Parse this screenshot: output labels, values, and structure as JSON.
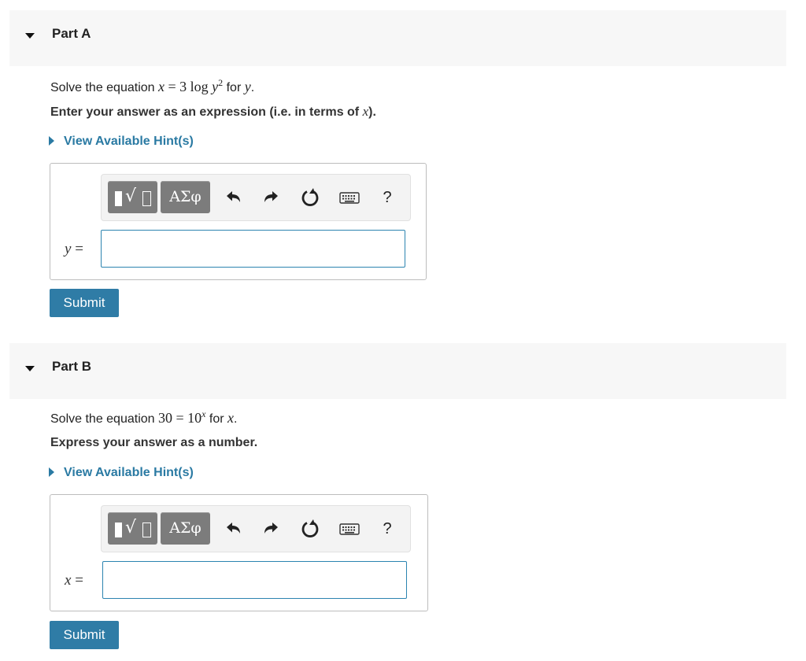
{
  "part_a": {
    "title": "Part A",
    "question_prefix": "Solve the equation",
    "eq_lhs": "x",
    "eq_op": " = 3 log ",
    "eq_var": "y",
    "eq_exp": "2",
    "question_for": " for ",
    "question_var": "y",
    "question_end": ".",
    "instruction_prefix": "Enter your answer as an expression (i.e. in terms of ",
    "instruction_var": "x",
    "instruction_suffix": ").",
    "hint_label": "View Available Hint(s)",
    "greek_label": "ΑΣφ",
    "help_label": "?",
    "answer_var": "y",
    "answer_eq": " =",
    "input_value": "",
    "submit_label": "Submit"
  },
  "part_b": {
    "title": "Part B",
    "question_prefix": "Solve the equation",
    "eq_text": "30 = 10",
    "eq_exp": "x",
    "question_for": " for ",
    "question_var": "x",
    "question_end": ".",
    "instruction": "Express your answer as a number.",
    "hint_label": "View Available Hint(s)",
    "greek_label": "ΑΣφ",
    "help_label": "?",
    "answer_var": "x",
    "answer_eq": " =",
    "input_value": "",
    "submit_label": "Submit"
  },
  "colors": {
    "accent": "#2f7ca6",
    "hint_link": "#2a7aa3",
    "header_bg": "#f7f7f7",
    "toolbar_button": "#7c7c7c"
  },
  "icons": [
    "templates-icon",
    "greek-letters-icon",
    "undo-icon",
    "redo-icon",
    "reset-icon",
    "keyboard-icon",
    "help-icon"
  ]
}
